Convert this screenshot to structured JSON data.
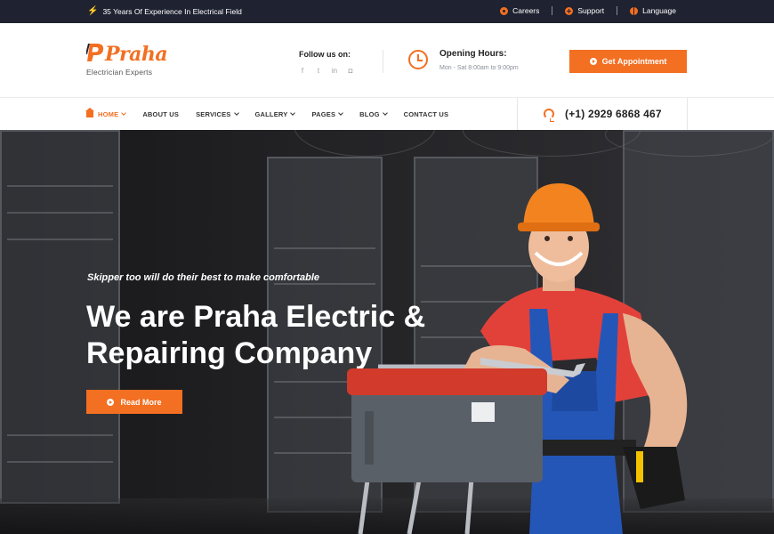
{
  "topbar": {
    "experience": "35 Years Of Experience In Electrical Field",
    "links": [
      {
        "label": "Careers",
        "icon": "gear-icon"
      },
      {
        "label": "Support",
        "icon": "lifebuoy-icon"
      },
      {
        "label": "Language",
        "icon": "globe-icon"
      }
    ]
  },
  "header": {
    "logo_text": "Praha",
    "logo_sub": "Electrician Experts",
    "follow_label": "Follow us on:",
    "socials": [
      "facebook-icon",
      "twitter-icon",
      "linkedin-icon",
      "instagram-icon"
    ],
    "hours_title": "Opening Hours:",
    "hours_value": "Mon - Sat 8:00am to 9:00pm",
    "appointment_label": "Get Appointment"
  },
  "nav": {
    "items": [
      {
        "label": "HOME",
        "active": true,
        "dropdown": true
      },
      {
        "label": "ABOUT US",
        "active": false,
        "dropdown": false
      },
      {
        "label": "SERVICES",
        "active": false,
        "dropdown": true
      },
      {
        "label": "GALLERY",
        "active": false,
        "dropdown": true
      },
      {
        "label": "PAGES",
        "active": false,
        "dropdown": true
      },
      {
        "label": "BLOG",
        "active": false,
        "dropdown": true
      },
      {
        "label": "CONTACT US",
        "active": false,
        "dropdown": false
      }
    ],
    "phone": "(+1) 2929 6868 467"
  },
  "hero": {
    "tagline": "Skipper too will do their best to make comfortable",
    "title_line1": "We are Praha Electric &",
    "title_line2": "Repairing Company",
    "cta_label": "Read More"
  },
  "colors": {
    "accent": "#f36f21",
    "topbar_bg": "#1f2230"
  }
}
